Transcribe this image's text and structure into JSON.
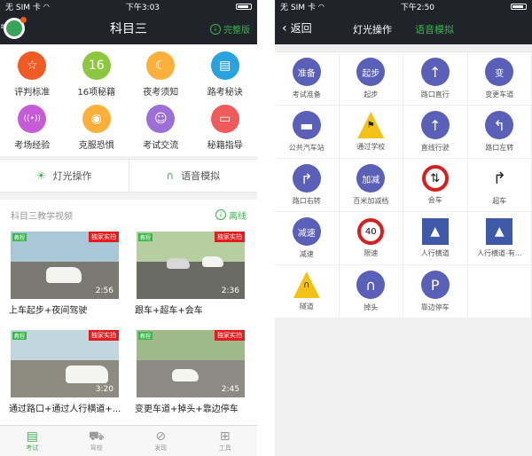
{
  "left": {
    "status": {
      "carrier": "无 SIM 卡",
      "time": "下午3:03"
    },
    "nav": {
      "title": "科目三",
      "right_label": "完整版"
    },
    "grid": [
      {
        "label": "评判标准",
        "icon": "star-icon",
        "color": "#f05a23",
        "glyph": "☆"
      },
      {
        "label": "16项秘籍",
        "icon": "sixteen-icon",
        "color": "#8dc63f",
        "glyph": "16"
      },
      {
        "label": "夜考须知",
        "icon": "moon-icon",
        "color": "#fbb03b",
        "glyph": "☾"
      },
      {
        "label": "路考秘诀",
        "icon": "book-icon",
        "color": "#29a3e0",
        "glyph": "▤"
      },
      {
        "label": "考场经验",
        "icon": "broadcast-icon",
        "color": "#c55bd6",
        "glyph": "((•))"
      },
      {
        "label": "克服恐惧",
        "icon": "eye-icon",
        "color": "#fbb03b",
        "glyph": "◉"
      },
      {
        "label": "考试交流",
        "icon": "users-icon",
        "color": "#9b6fd6",
        "glyph": "☺"
      },
      {
        "label": "秘籍指导",
        "icon": "chat-icon",
        "color": "#ef5a5a",
        "glyph": "▭"
      }
    ],
    "modes": [
      {
        "label": "灯光操作",
        "icon": "light-icon",
        "glyph": "☀"
      },
      {
        "label": "语音模拟",
        "icon": "headphones-icon",
        "glyph": "🎧"
      }
    ],
    "video_header": {
      "title": "科目三教学视频",
      "offline": "离线"
    },
    "videos": [
      {
        "title": "上车起步+夜间驾驶",
        "duration": "2:56",
        "tag": "独家实拍",
        "badge": "教程",
        "sky": "#a9c7d6",
        "ground": "#7a7a72"
      },
      {
        "title": "跟车+超车+会车",
        "duration": "2:36",
        "tag": "独家实拍",
        "badge": "教程",
        "sky": "#b7cfa0",
        "ground": "#6b6b66"
      },
      {
        "title": "通过路口+通过人行横道+...",
        "duration": "3:20",
        "tag": "独家实拍",
        "badge": "教程",
        "sky": "#c2d6e0",
        "ground": "#8d8a80"
      },
      {
        "title": "变更车道+掉头+靠边停车",
        "duration": "2:45",
        "tag": "独家实拍",
        "badge": "教程",
        "sky": "#9fb98a",
        "ground": "#8b8b83"
      }
    ],
    "tabs": [
      {
        "label": "考试",
        "icon": "exam-icon",
        "glyph": "▤"
      },
      {
        "label": "驾校",
        "icon": "car-icon",
        "glyph": "⛟"
      },
      {
        "label": "发现",
        "icon": "compass-icon",
        "glyph": "⊘"
      },
      {
        "label": "工具",
        "icon": "toolbox-icon",
        "glyph": "⊞"
      }
    ]
  },
  "right": {
    "status": {
      "carrier": "无 SIM 卡",
      "time": "下午2:50"
    },
    "nav": {
      "back": "返回",
      "tab1": "灯光操作",
      "tab2": "语音模拟"
    },
    "signs": [
      {
        "label": "考试准备",
        "kind": "text",
        "text": "准备"
      },
      {
        "label": "起步",
        "kind": "text",
        "text": "起步"
      },
      {
        "label": "路口直行",
        "kind": "glyph",
        "text": "↑"
      },
      {
        "label": "变更车道",
        "kind": "text",
        "text": "变"
      },
      {
        "label": "公共汽车站",
        "kind": "glyph",
        "text": "▬"
      },
      {
        "label": "通过学校",
        "kind": "triangle",
        "text": "⚑"
      },
      {
        "label": "直线行驶",
        "kind": "glyph",
        "text": "↑"
      },
      {
        "label": "路口左转",
        "kind": "glyph",
        "text": "↰"
      },
      {
        "label": "路口右转",
        "kind": "glyph",
        "text": "↱"
      },
      {
        "label": "百米加减档",
        "kind": "text",
        "text": "加减"
      },
      {
        "label": "会车",
        "kind": "meet",
        "text": "⇅"
      },
      {
        "label": "超车",
        "kind": "plain",
        "text": "↱"
      },
      {
        "label": "减速",
        "kind": "text",
        "text": "减速"
      },
      {
        "label": "限速",
        "kind": "limit",
        "text": "40"
      },
      {
        "label": "人行横道",
        "kind": "square",
        "text": "▲"
      },
      {
        "label": "人行横道-有...",
        "kind": "square",
        "text": "▲"
      },
      {
        "label": "隧道",
        "kind": "triangle",
        "text": "∩"
      },
      {
        "label": "掉头",
        "kind": "glyph",
        "text": "∩"
      },
      {
        "label": "靠边停车",
        "kind": "glyph",
        "text": "P"
      }
    ]
  }
}
